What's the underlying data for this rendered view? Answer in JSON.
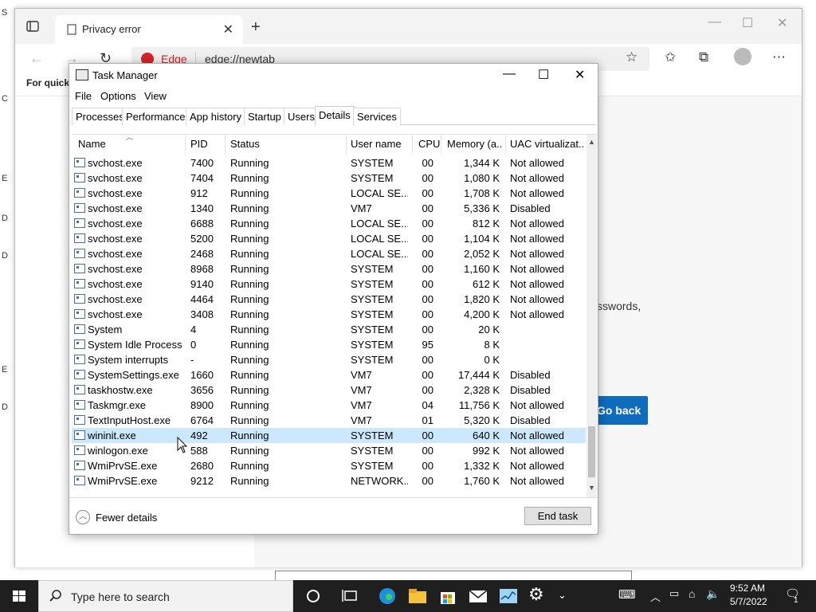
{
  "edge": {
    "tab_title": "Privacy error",
    "badge_text": "Edge",
    "url": "edge://newtab",
    "favorites_bar_text": "For quick",
    "page_text": "sswords,",
    "go_back_label": "Go back"
  },
  "desktop_left_letters": [
    "S",
    "C",
    "E",
    "D",
    "D",
    "E",
    "D"
  ],
  "task_manager": {
    "title": "Task Manager",
    "menu": [
      "File",
      "Options",
      "View"
    ],
    "tabs": [
      "Processes",
      "Performance",
      "App history",
      "Startup",
      "Users",
      "Details",
      "Services"
    ],
    "active_tab": "Details",
    "columns": [
      "Name",
      "PID",
      "Status",
      "User name",
      "CPU",
      "Memory (a...",
      "UAC virtualizat..."
    ],
    "rows": [
      {
        "name": "svchost.exe",
        "pid": "7400",
        "status": "Running",
        "user": "SYSTEM",
        "cpu": "00",
        "mem": "1,344 K",
        "uac": "Not allowed"
      },
      {
        "name": "svchost.exe",
        "pid": "7404",
        "status": "Running",
        "user": "SYSTEM",
        "cpu": "00",
        "mem": "1,080 K",
        "uac": "Not allowed"
      },
      {
        "name": "svchost.exe",
        "pid": "912",
        "status": "Running",
        "user": "LOCAL SE...",
        "cpu": "00",
        "mem": "1,708 K",
        "uac": "Not allowed"
      },
      {
        "name": "svchost.exe",
        "pid": "1340",
        "status": "Running",
        "user": "VM7",
        "cpu": "00",
        "mem": "5,336 K",
        "uac": "Disabled"
      },
      {
        "name": "svchost.exe",
        "pid": "6688",
        "status": "Running",
        "user": "LOCAL SE...",
        "cpu": "00",
        "mem": "812 K",
        "uac": "Not allowed"
      },
      {
        "name": "svchost.exe",
        "pid": "5200",
        "status": "Running",
        "user": "LOCAL SE...",
        "cpu": "00",
        "mem": "1,104 K",
        "uac": "Not allowed"
      },
      {
        "name": "svchost.exe",
        "pid": "2468",
        "status": "Running",
        "user": "LOCAL SE...",
        "cpu": "00",
        "mem": "2,052 K",
        "uac": "Not allowed"
      },
      {
        "name": "svchost.exe",
        "pid": "8968",
        "status": "Running",
        "user": "SYSTEM",
        "cpu": "00",
        "mem": "1,160 K",
        "uac": "Not allowed"
      },
      {
        "name": "svchost.exe",
        "pid": "9140",
        "status": "Running",
        "user": "SYSTEM",
        "cpu": "00",
        "mem": "612 K",
        "uac": "Not allowed"
      },
      {
        "name": "svchost.exe",
        "pid": "4464",
        "status": "Running",
        "user": "SYSTEM",
        "cpu": "00",
        "mem": "1,820 K",
        "uac": "Not allowed"
      },
      {
        "name": "svchost.exe",
        "pid": "3408",
        "status": "Running",
        "user": "SYSTEM",
        "cpu": "00",
        "mem": "4,200 K",
        "uac": "Not allowed"
      },
      {
        "name": "System",
        "pid": "4",
        "status": "Running",
        "user": "SYSTEM",
        "cpu": "00",
        "mem": "20 K",
        "uac": ""
      },
      {
        "name": "System Idle Process",
        "pid": "0",
        "status": "Running",
        "user": "SYSTEM",
        "cpu": "95",
        "mem": "8 K",
        "uac": ""
      },
      {
        "name": "System interrupts",
        "pid": "-",
        "status": "Running",
        "user": "SYSTEM",
        "cpu": "00",
        "mem": "0 K",
        "uac": ""
      },
      {
        "name": "SystemSettings.exe",
        "pid": "1660",
        "status": "Running",
        "user": "VM7",
        "cpu": "00",
        "mem": "17,444 K",
        "uac": "Disabled"
      },
      {
        "name": "taskhostw.exe",
        "pid": "3656",
        "status": "Running",
        "user": "VM7",
        "cpu": "00",
        "mem": "2,328 K",
        "uac": "Disabled"
      },
      {
        "name": "Taskmgr.exe",
        "pid": "8900",
        "status": "Running",
        "user": "VM7",
        "cpu": "04",
        "mem": "11,756 K",
        "uac": "Not allowed"
      },
      {
        "name": "TextInputHost.exe",
        "pid": "6764",
        "status": "Running",
        "user": "VM7",
        "cpu": "01",
        "mem": "5,320 K",
        "uac": "Disabled"
      },
      {
        "name": "wininit.exe",
        "pid": "492",
        "status": "Running",
        "user": "SYSTEM",
        "cpu": "00",
        "mem": "640 K",
        "uac": "Not allowed",
        "selected": true
      },
      {
        "name": "winlogon.exe",
        "pid": "588",
        "status": "Running",
        "user": "SYSTEM",
        "cpu": "00",
        "mem": "992 K",
        "uac": "Not allowed"
      },
      {
        "name": "WmiPrvSE.exe",
        "pid": "2680",
        "status": "Running",
        "user": "SYSTEM",
        "cpu": "00",
        "mem": "1,332 K",
        "uac": "Not allowed"
      },
      {
        "name": "WmiPrvSE.exe",
        "pid": "9212",
        "status": "Running",
        "user": "NETWORK...",
        "cpu": "00",
        "mem": "1,760 K",
        "uac": "Not allowed"
      }
    ],
    "fewer_details_label": "Fewer details",
    "end_task_label": "End task"
  },
  "taskbar": {
    "search_placeholder": "Type here to search",
    "time": "9:52 AM",
    "date": "5/7/2022",
    "notification_count": "1"
  },
  "colors": {
    "selected_row": "#cce8ff",
    "edge_accent": "#0f6cbd",
    "edge_red": "#d8232a",
    "taskbar_bg": "#1f1f1f"
  }
}
